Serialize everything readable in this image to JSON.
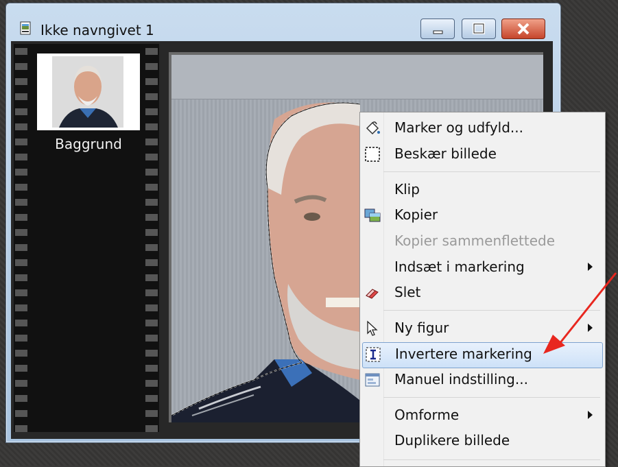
{
  "window": {
    "title": "Ikke navngivet 1",
    "icon": "film-document-icon",
    "buttons": [
      "minimize",
      "maximize",
      "close"
    ]
  },
  "layers_panel": {
    "layers": [
      {
        "label": "Baggrund"
      }
    ]
  },
  "context_menu": {
    "items": [
      {
        "label": "Marker og udfyld...",
        "icon": "paint-bucket-icon",
        "enabled": true,
        "submenu": false
      },
      {
        "label": "Beskær billede",
        "icon": "crop-icon",
        "enabled": true,
        "submenu": false
      },
      {
        "label": "Klip",
        "icon": "",
        "enabled": true,
        "submenu": false
      },
      {
        "label": "Kopier",
        "icon": "copy-picture-icon",
        "enabled": true,
        "submenu": false
      },
      {
        "label": "Kopier sammenflettede",
        "icon": "",
        "enabled": false,
        "submenu": false
      },
      {
        "label": "Indsæt i markering",
        "icon": "",
        "enabled": true,
        "submenu": true
      },
      {
        "label": "Slet",
        "icon": "eraser-icon",
        "enabled": true,
        "submenu": false
      },
      {
        "label": "Ny figur",
        "icon": "pointer-icon",
        "enabled": true,
        "submenu": true
      },
      {
        "label": "Invertere markering",
        "icon": "invert-selection-icon",
        "enabled": true,
        "submenu": false,
        "highlighted": true
      },
      {
        "label": "Manuel indstilling...",
        "icon": "settings-panel-icon",
        "enabled": true,
        "submenu": false
      },
      {
        "label": "Omforme",
        "icon": "",
        "enabled": true,
        "submenu": true
      },
      {
        "label": "Duplikere billede",
        "icon": "",
        "enabled": true,
        "submenu": false
      }
    ]
  },
  "colors": {
    "highlight": "#cde1f8",
    "annotation_arrow": "#e8271f",
    "menu_bg": "#f1f1f1"
  }
}
